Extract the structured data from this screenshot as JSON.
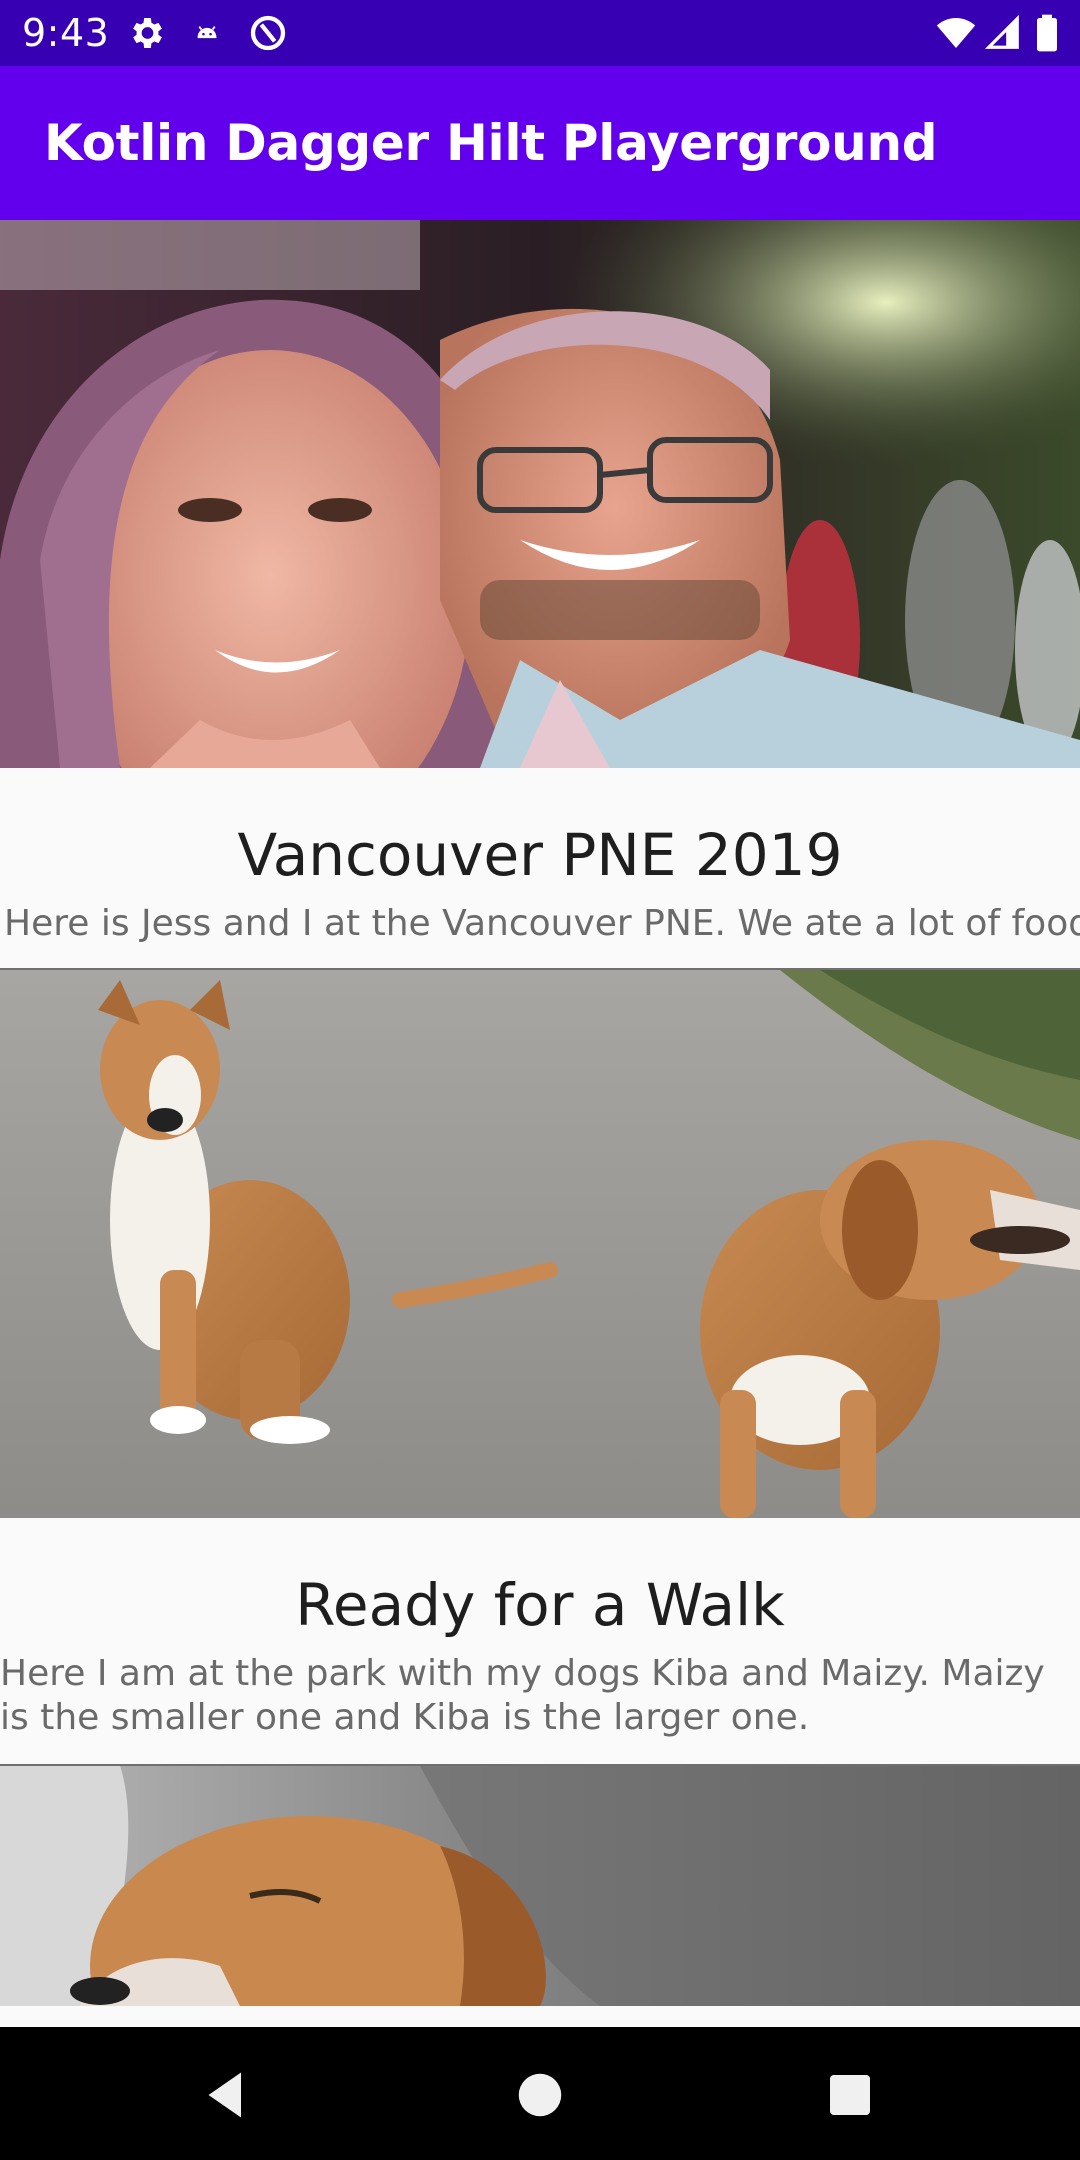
{
  "status_bar": {
    "time": "9:43",
    "icons": [
      "settings-gear-icon",
      "android-debug-icon",
      "sync-icon",
      "wifi-icon",
      "cellular-signal-icon",
      "battery-icon"
    ]
  },
  "app_bar": {
    "title": "Kotlin Dagger Hilt Playerground",
    "color": "#6200ee",
    "status_color": "#3700b3"
  },
  "feed": {
    "posts": [
      {
        "title": "Vancouver PNE 2019",
        "body": "Here is Jess and I at the Vancouver PNE. We ate a lot of food."
      },
      {
        "title": "Ready for a Walk",
        "body": "Here I am at the park with my dogs Kiba and Maizy. Maizy is the smaller one and Kiba is the larger one."
      },
      {
        "title": "",
        "body": ""
      }
    ]
  },
  "nav_bar": {
    "buttons": [
      "back-icon",
      "home-icon",
      "recents-icon"
    ]
  }
}
